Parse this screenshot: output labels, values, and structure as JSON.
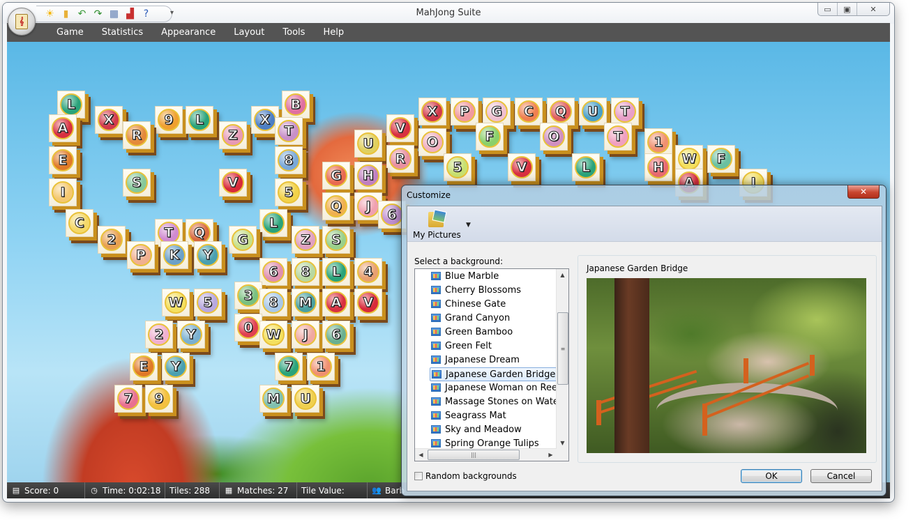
{
  "window": {
    "title": "MahJong Suite",
    "controls": {
      "minimize": "minimize",
      "maximize": "restore",
      "close": "close"
    }
  },
  "quick_access": [
    {
      "name": "new-game-icon",
      "glyph": "☀"
    },
    {
      "name": "open-icon",
      "glyph": "▮"
    },
    {
      "name": "undo-icon",
      "glyph": "↶"
    },
    {
      "name": "redo-icon",
      "glyph": "↷"
    },
    {
      "name": "layout-icon",
      "glyph": "▦"
    },
    {
      "name": "statistics-icon",
      "glyph": "▟"
    },
    {
      "name": "help-icon",
      "glyph": "?"
    }
  ],
  "menu": [
    "Game",
    "Statistics",
    "Appearance",
    "Layout",
    "Tools",
    "Help"
  ],
  "status": {
    "score": "Score: 0",
    "time": "Time: 0:02:18",
    "tiles": "Tiles: 288",
    "matches": "Matches: 27",
    "tile_value": "Tile Value:",
    "player": "Barb"
  },
  "tiles": [
    {
      "c": "L",
      "bg": "#2aa37a"
    },
    {
      "c": "X",
      "bg": "#d23b4b"
    },
    {
      "c": "9",
      "bg": "#f0a030"
    },
    {
      "c": "L",
      "bg": "#2aa37a"
    },
    {
      "c": "Z",
      "bg": "#e79ab5"
    },
    {
      "c": "X",
      "bg": "#4d7fc4"
    },
    {
      "c": "B",
      "bg": "#e070a0"
    },
    {
      "c": "A",
      "bg": "#d83040"
    },
    {
      "c": "R",
      "bg": "#e48a3a"
    },
    {
      "c": "T",
      "bg": "#c890c8"
    },
    {
      "c": "E",
      "bg": "#e07a28"
    },
    {
      "c": "8",
      "bg": "#7aa8d8"
    },
    {
      "c": "I",
      "bg": "#f4c870"
    },
    {
      "c": "S",
      "bg": "#86c89a"
    },
    {
      "c": "V",
      "bg": "#d82a3a"
    },
    {
      "c": "5",
      "bg": "#f2d24a"
    },
    {
      "c": "C",
      "bg": "#f4d868"
    },
    {
      "c": "L",
      "bg": "#2aa37a"
    },
    {
      "c": "2",
      "bg": "#e8a050"
    },
    {
      "c": "T",
      "bg": "#d08ad0"
    },
    {
      "c": "Q",
      "bg": "#d86a40"
    },
    {
      "c": "G",
      "bg": "#c8e08a"
    },
    {
      "c": "Z",
      "bg": "#e0a0c0"
    },
    {
      "c": "S",
      "bg": "#9ad08a"
    },
    {
      "c": "P",
      "bg": "#f0b090"
    },
    {
      "c": "K",
      "bg": "#6aa0c8"
    },
    {
      "c": "Y",
      "bg": "#4aa0b0"
    },
    {
      "c": "6",
      "bg": "#e090b0"
    },
    {
      "c": "8",
      "bg": "#b8d8a0"
    },
    {
      "c": "L",
      "bg": "#2aa37a"
    },
    {
      "c": "4",
      "bg": "#e8a070"
    },
    {
      "c": "W",
      "bg": "#f4e060"
    },
    {
      "c": "5",
      "bg": "#b8a8e0"
    },
    {
      "c": "3",
      "bg": "#7ac080"
    },
    {
      "c": "8",
      "bg": "#a8c8e8"
    },
    {
      "c": "M",
      "bg": "#4aa0a0"
    },
    {
      "c": "A",
      "bg": "#d83040"
    },
    {
      "c": "V",
      "bg": "#d82a3a"
    },
    {
      "c": "2",
      "bg": "#f0b0d0"
    },
    {
      "c": "Y",
      "bg": "#7ab0d0"
    },
    {
      "c": "0",
      "bg": "#e04050"
    },
    {
      "c": "W",
      "bg": "#f4e060"
    },
    {
      "c": "J",
      "bg": "#f0a8a0"
    },
    {
      "c": "6",
      "bg": "#6ab090"
    },
    {
      "c": "E",
      "bg": "#e07a28"
    },
    {
      "c": "Y",
      "bg": "#4aa0b0"
    },
    {
      "c": "7",
      "bg": "#2aa37a"
    },
    {
      "c": "1",
      "bg": "#f09070"
    },
    {
      "c": "7",
      "bg": "#e87090"
    },
    {
      "c": "9",
      "bg": "#f4c040"
    },
    {
      "c": "M",
      "bg": "#80c0b0"
    },
    {
      "c": "U",
      "bg": "#f0d050"
    },
    {
      "c": "U",
      "bg": "#e0d060"
    },
    {
      "c": "V",
      "bg": "#d83040"
    },
    {
      "c": "R",
      "bg": "#e890a0"
    },
    {
      "c": "G",
      "bg": "#e86a50"
    },
    {
      "c": "H",
      "bg": "#c080c0"
    },
    {
      "c": "Q",
      "bg": "#f0b050"
    },
    {
      "c": "J",
      "bg": "#f0a0b0"
    },
    {
      "c": "6",
      "bg": "#c090d0"
    },
    {
      "c": "X",
      "bg": "#d23b4b"
    },
    {
      "c": "P",
      "bg": "#f09aa0"
    },
    {
      "c": "G",
      "bg": "#f0c0d0"
    },
    {
      "c": "C",
      "bg": "#f08050"
    },
    {
      "c": "Q",
      "bg": "#e06060"
    },
    {
      "c": "U",
      "bg": "#4aa0c8"
    },
    {
      "c": "T",
      "bg": "#e8a0c8"
    },
    {
      "c": "O",
      "bg": "#f0b0c0"
    },
    {
      "c": "F",
      "bg": "#8ad06a"
    },
    {
      "c": "O",
      "bg": "#d090c0"
    },
    {
      "c": "T",
      "bg": "#f0a0c0"
    },
    {
      "c": "1",
      "bg": "#f09070"
    },
    {
      "c": "5",
      "bg": "#c8e070"
    },
    {
      "c": "V",
      "bg": "#d83040"
    },
    {
      "c": "L",
      "bg": "#2aa37a"
    },
    {
      "c": "H",
      "bg": "#e86a70"
    },
    {
      "c": "W",
      "bg": "#f4e060"
    },
    {
      "c": "F",
      "bg": "#6ac0a0"
    },
    {
      "c": "A",
      "bg": "#d83040"
    },
    {
      "c": "I",
      "bg": "#f4e060"
    }
  ],
  "dialog": {
    "title": "Customize",
    "toolbar": {
      "source_label": "My Pictures"
    },
    "list_label": "Select a background:",
    "backgrounds": [
      "Blue Marble",
      "Cherry Blossoms",
      "Chinese Gate",
      "Grand Canyon",
      "Green Bamboo",
      "Green Felt",
      "Japanese Dream",
      "Japanese Garden Bridge",
      "Japanese Woman on Reed",
      "Massage Stones on Water",
      "Seagrass Mat",
      "Sky and Meadow",
      "Spring Orange Tulips"
    ],
    "selected": "Japanese Garden Bridge",
    "preview_title": "Japanese Garden Bridge",
    "random_label": "Random backgrounds",
    "random_checked": false,
    "ok_label": "OK",
    "cancel_label": "Cancel",
    "close_glyph": "✕"
  }
}
